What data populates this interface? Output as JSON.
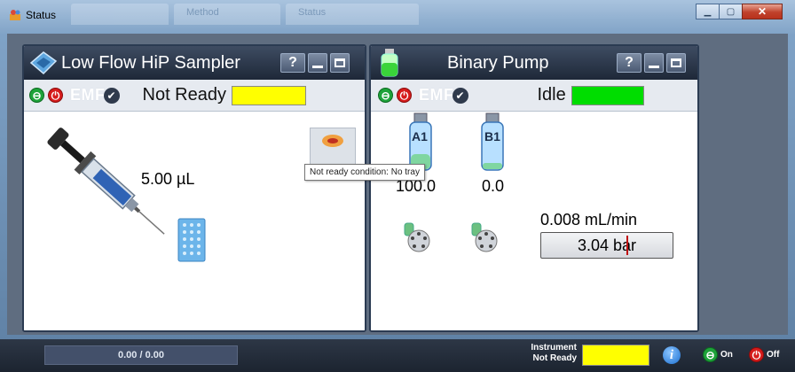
{
  "window": {
    "title": "Status",
    "ghost_tabs": [
      "",
      "Method",
      "Status"
    ],
    "controls": {
      "minimize": "▁",
      "maximize": "▢",
      "close": "✕"
    }
  },
  "sampler": {
    "title": "Low Flow HiP Sampler",
    "help": "?",
    "emf": "EMF",
    "status": "Not Ready",
    "status_color": "#ffff00",
    "volume": "5.00 µL",
    "tooltip": "Not ready condition: No tray"
  },
  "pump": {
    "title": "Binary Pump",
    "help": "?",
    "emf": "EMF",
    "status": "Idle",
    "status_color": "#00dd00",
    "solvents": [
      {
        "label": "A1",
        "value": "100.0"
      },
      {
        "label": "B1",
        "value": "0.0"
      }
    ],
    "flow": "0.008 mL/min",
    "pressure": "3.04 bar"
  },
  "bottom": {
    "progress": "0.00 / 0.00",
    "instrument_label_line1": "Instrument",
    "instrument_label_line2": "Not Ready",
    "instrument_color": "#ffff00",
    "info": "i",
    "on_label": "On",
    "off_label": "Off"
  },
  "colors": {
    "on": "#1fa33a",
    "off": "#d61c1c",
    "header": "#1e2838"
  }
}
